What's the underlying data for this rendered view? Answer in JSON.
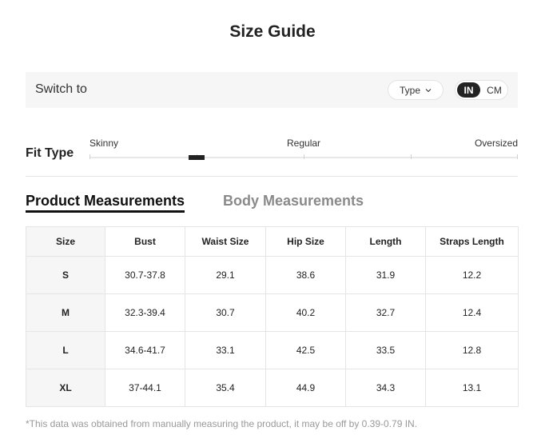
{
  "title": "Size Guide",
  "switch_bar": {
    "label": "Switch to",
    "type_dropdown": "Type",
    "units": {
      "active": "IN",
      "inactive": "CM"
    }
  },
  "fit_type": {
    "label": "Fit Type",
    "options": [
      "Skinny",
      "Regular",
      "Oversized"
    ]
  },
  "tabs": {
    "active": "Product Measurements",
    "inactive": "Body Measurements"
  },
  "table": {
    "headers": [
      "Size",
      "Bust",
      "Waist Size",
      "Hip Size",
      "Length",
      "Straps Length"
    ],
    "rows": [
      [
        "S",
        "30.7-37.8",
        "29.1",
        "38.6",
        "31.9",
        "12.2"
      ],
      [
        "M",
        "32.3-39.4",
        "30.7",
        "40.2",
        "32.7",
        "12.4"
      ],
      [
        "L",
        "34.6-41.7",
        "33.1",
        "42.5",
        "33.5",
        "12.8"
      ],
      [
        "XL",
        "37-44.1",
        "35.4",
        "44.9",
        "34.3",
        "13.1"
      ]
    ]
  },
  "footnote": "*This data was obtained from manually measuring the product, it may be off by 0.39-0.79 IN."
}
